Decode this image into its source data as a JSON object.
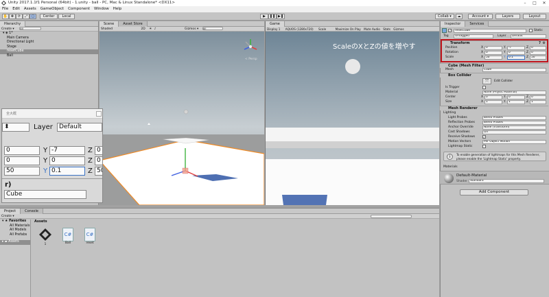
{
  "window": {
    "title": "Unity 2017.1.1f1 Personal (64bit) - 1.unity - ball - PC, Mac & Linux Standalone* <DX11>"
  },
  "menu": [
    "File",
    "Edit",
    "Assets",
    "GameObject",
    "Component",
    "Window",
    "Help"
  ],
  "toolbar": {
    "center": "Center",
    "local": "Local",
    "collab": "Collab ▾",
    "account": "Account ▾",
    "layers": "Layers",
    "layout": "Layout"
  },
  "hierarchy": {
    "tab": "Hierarchy",
    "create": "Create ▾",
    "search": "All",
    "scene": "1*",
    "items": [
      "Main Camera",
      "Directional Light",
      "Stage",
      "resetCube",
      "Ball"
    ],
    "selected": "resetCube"
  },
  "scene": {
    "tab": "Scene",
    "tab2": "Asset Store",
    "shading": "Shaded",
    "mode": "2D",
    "gizmos": "Gizmos ▾",
    "search": "All",
    "persp": "< Persp"
  },
  "game": {
    "tab": "Game",
    "display": "Display 1",
    "resolution": "AQUOS (1280x720)",
    "scale": "Scale",
    "maximize": "Maximize On Play",
    "mute": "Mute Audio",
    "stats": "Stats",
    "gizmos": "Gizmos",
    "annotation": "ScaleのXとZの値を増やす"
  },
  "zoom": {
    "header": "全大概",
    "layer_label": "Layer",
    "layer_value": "Default",
    "row1": {
      "x": "0",
      "y": "-7",
      "z": "0"
    },
    "row2": {
      "x": "0",
      "y": "0",
      "z": "0"
    },
    "row3": {
      "x": "50",
      "y": "0.1",
      "z": "50"
    },
    "frag": "r)",
    "mesh": "Cube"
  },
  "inspector": {
    "tab": "Inspector",
    "tab2": "Services",
    "name": "resetCube",
    "static": "Static",
    "tag_label": "Tag",
    "tag_value": "Untagged",
    "layer_label": "Layer",
    "layer_value": "Default",
    "transform": {
      "title": "Transform",
      "position_label": "Position",
      "rotation_label": "Rotation",
      "scale_label": "Scale",
      "position": {
        "x": "0",
        "y": "-7",
        "z": "0"
      },
      "rotation": {
        "x": "0",
        "y": "0",
        "z": "0"
      },
      "scale": {
        "x": "50",
        "y": "0.1",
        "z": "50"
      }
    },
    "mesh_filter": {
      "title": "Cube (Mesh Filter)",
      "label": "Mesh",
      "value": "Cube"
    },
    "box_collider": {
      "title": "Box Collider",
      "edit": "Edit Collider",
      "trigger_label": "Is Trigger",
      "material_label": "Material",
      "material_value": "None (Physic Material)",
      "center_label": "Center",
      "center": {
        "x": "0",
        "y": "0",
        "z": "0"
      },
      "size_label": "Size",
      "size": {
        "x": "1",
        "y": "1",
        "z": "1"
      }
    },
    "mesh_renderer": {
      "title": "Mesh Renderer",
      "lighting": "Lighting",
      "light_probes_label": "Light Probes",
      "light_probes": "Blend Probes",
      "reflection_label": "Reflection Probes",
      "reflection": "Blend Probes",
      "anchor_label": "Anchor Override",
      "anchor": "None (Transform)",
      "cast_label": "Cast Shadows",
      "cast": "On",
      "receive_label": "Receive Shadows",
      "motion_label": "Motion Vectors",
      "motion": "Per Object Motion",
      "lightmap_label": "Lightmap Static",
      "info": "To enable generation of lightmaps for this Mesh Renderer, please enable the 'Lightmap Static' property."
    },
    "materials": "Materials",
    "material": {
      "name": "Default-Material",
      "shader_label": "Shader",
      "shader": "Standard"
    },
    "add_component": "Add Component"
  },
  "project": {
    "tab": "Project",
    "tab2": "Console",
    "create": "Create ▾",
    "favorites": "Favorites",
    "fav_items": [
      "All Materials",
      "All Models",
      "All Prefabs"
    ],
    "assets_label": "Assets",
    "header": "Assets",
    "assets": [
      {
        "name": "1",
        "kind": "unity"
      },
      {
        "name": "Ball",
        "kind": "cs"
      },
      {
        "name": "reset",
        "kind": "cs"
      }
    ]
  },
  "colors": {
    "accent": "#3a72c4",
    "annotation_box": "#c0141c",
    "selection_orange": "#f08a24"
  }
}
